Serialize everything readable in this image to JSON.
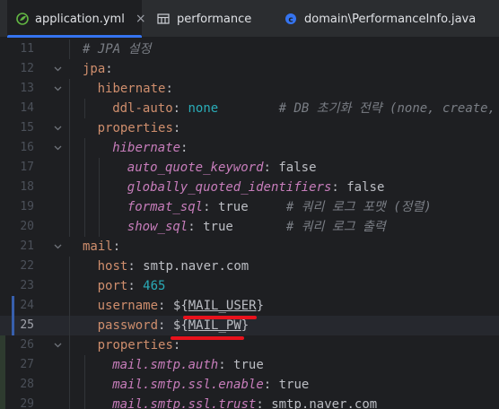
{
  "tabs": [
    {
      "label": "application.yml",
      "icon": "spring-leaf-icon",
      "active": true,
      "close": "×"
    },
    {
      "label": "performance",
      "icon": "table-icon",
      "active": false
    },
    {
      "label": "domain\\PerformanceInfo.java",
      "icon": "class-icon",
      "active": false
    }
  ],
  "lines": [
    {
      "num": "11",
      "parts": [
        {
          "t": "# JPA 설정",
          "c": "c"
        }
      ]
    },
    {
      "num": "12",
      "parts": [
        {
          "t": "jpa",
          "c": "k"
        },
        {
          "t": ":",
          "c": "plain"
        }
      ]
    },
    {
      "num": "13",
      "parts": [
        {
          "t": "hibernate",
          "c": "k"
        },
        {
          "t": ":",
          "c": "plain"
        }
      ]
    },
    {
      "num": "14",
      "parts": [
        {
          "t": "ddl-auto",
          "c": "k"
        },
        {
          "t": ": ",
          "c": "plain"
        },
        {
          "t": "none",
          "c": "n"
        },
        {
          "t": "        # DB 초기화 전략 (none, create, c",
          "c": "c"
        }
      ]
    },
    {
      "num": "15",
      "parts": [
        {
          "t": "properties",
          "c": "k"
        },
        {
          "t": ":",
          "c": "plain"
        }
      ]
    },
    {
      "num": "16",
      "parts": [
        {
          "t": "hibernate",
          "c": "kk"
        },
        {
          "t": ":",
          "c": "plain"
        }
      ]
    },
    {
      "num": "17",
      "parts": [
        {
          "t": "auto_quote_keyword",
          "c": "kk"
        },
        {
          "t": ": false",
          "c": "plain"
        }
      ]
    },
    {
      "num": "18",
      "parts": [
        {
          "t": "globally_quoted_identifiers",
          "c": "kk"
        },
        {
          "t": ": false",
          "c": "plain"
        }
      ]
    },
    {
      "num": "19",
      "parts": [
        {
          "t": "format_sql",
          "c": "kk"
        },
        {
          "t": ": true     ",
          "c": "plain"
        },
        {
          "t": "# 쿼리 로그 포맷 (정렬)",
          "c": "c"
        }
      ]
    },
    {
      "num": "20",
      "parts": [
        {
          "t": "show_sql",
          "c": "kk"
        },
        {
          "t": ": true       ",
          "c": "plain"
        },
        {
          "t": "# 쿼리 로그 출력",
          "c": "c"
        }
      ]
    },
    {
      "num": "21",
      "parts": [
        {
          "t": "mail",
          "c": "k"
        },
        {
          "t": ":",
          "c": "plain"
        }
      ]
    },
    {
      "num": "22",
      "parts": [
        {
          "t": "host",
          "c": "k"
        },
        {
          "t": ": smtp.naver.com",
          "c": "plain"
        }
      ]
    },
    {
      "num": "23",
      "parts": [
        {
          "t": "port",
          "c": "k"
        },
        {
          "t": ": ",
          "c": "plain"
        },
        {
          "t": "465",
          "c": "n"
        }
      ]
    },
    {
      "num": "24",
      "parts": [
        {
          "t": "username",
          "c": "k"
        },
        {
          "t": ": ${",
          "c": "plain"
        },
        {
          "t": "MAIL_USER",
          "c": "ul"
        },
        {
          "t": "}",
          "c": "plain"
        }
      ]
    },
    {
      "num": "25",
      "parts": [
        {
          "t": "password",
          "c": "k"
        },
        {
          "t": ": ${",
          "c": "plain"
        },
        {
          "t": "MAIL_PW",
          "c": "ul"
        },
        {
          "t": "}",
          "c": "plain"
        }
      ]
    },
    {
      "num": "26",
      "parts": [
        {
          "t": "properties",
          "c": "k"
        },
        {
          "t": ":",
          "c": "plain"
        }
      ]
    },
    {
      "num": "27",
      "parts": [
        {
          "t": "mail.smtp.auth",
          "c": "kk"
        },
        {
          "t": ": true",
          "c": "plain"
        }
      ]
    },
    {
      "num": "28",
      "parts": [
        {
          "t": "mail.smtp.ssl.enable",
          "c": "kk"
        },
        {
          "t": ": true",
          "c": "plain"
        }
      ]
    },
    {
      "num": "29",
      "parts": [
        {
          "t": "mail.smtp.ssl.trust",
          "c": "kk"
        },
        {
          "t": ": smtp.naver.com",
          "c": "plain"
        }
      ]
    }
  ]
}
